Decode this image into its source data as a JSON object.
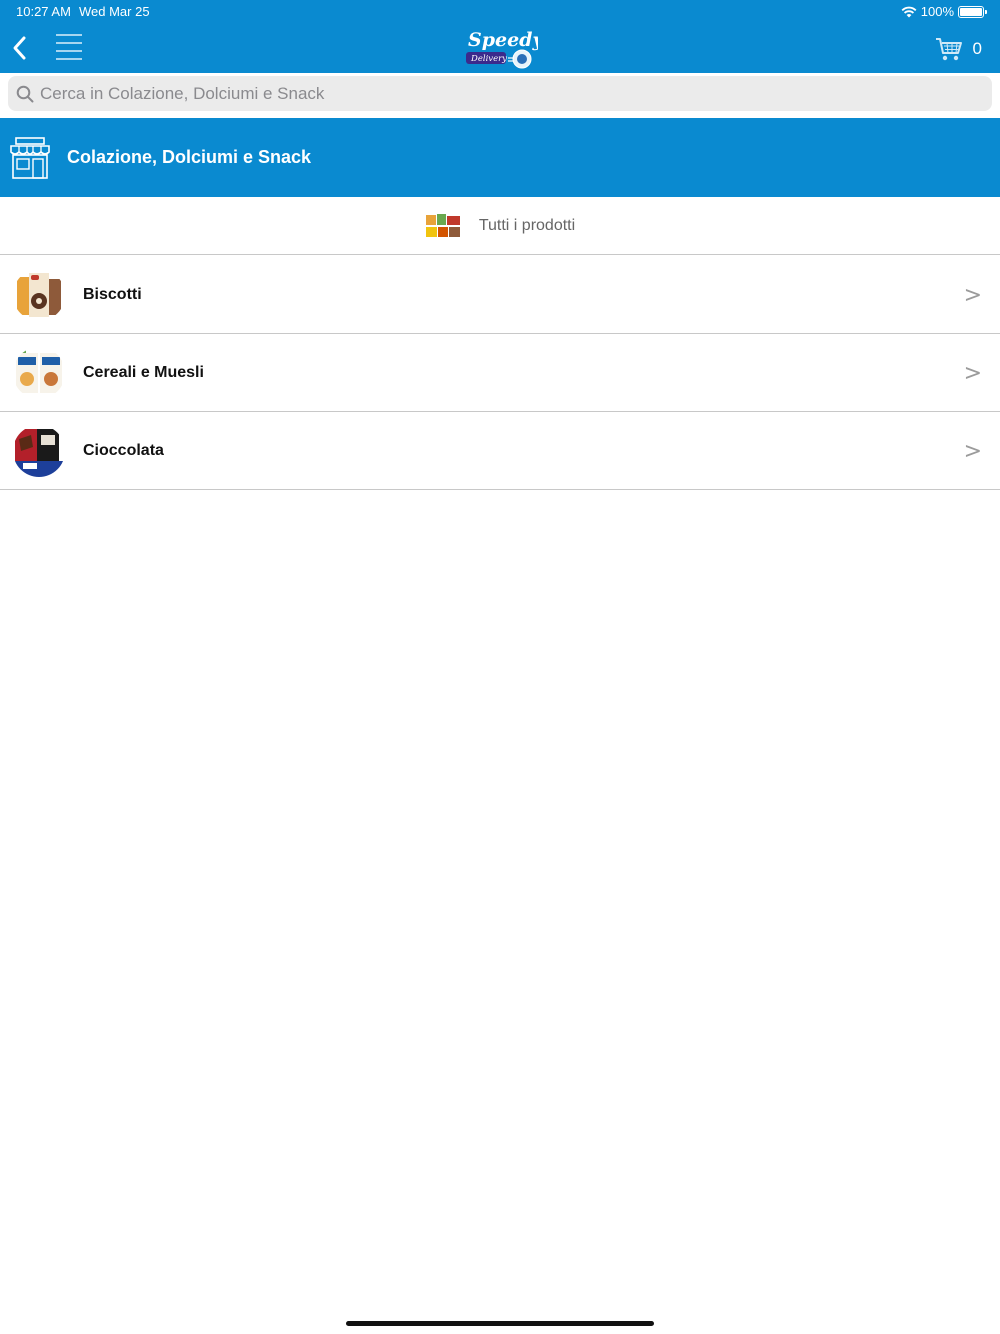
{
  "status_bar": {
    "time": "10:27 AM",
    "date": "Wed Mar 25",
    "battery": "100%",
    "battery_level": 1.0,
    "icons": [
      "wifi-icon",
      "battery-icon"
    ]
  },
  "nav": {
    "back_icon": "chevron-left-icon",
    "menu_icon": "hamburger-menu-icon",
    "logo_text": "Speedy",
    "logo_subtext": "Delivery",
    "cart_icon": "shopping-cart-icon",
    "cart_count": "0"
  },
  "search": {
    "placeholder": "Cerca in Colazione, Dolciumi e Snack",
    "value": "",
    "icon": "search-icon"
  },
  "category": {
    "icon": "store-icon",
    "title": "Colazione, Dolciumi e Snack"
  },
  "all_products": {
    "label": "Tutti i prodotti",
    "icon": "products-thumbnail"
  },
  "subcategories": [
    {
      "label": "Biscotti",
      "chevron": ">"
    },
    {
      "label": "Cereali e Muesli",
      "chevron": ">"
    },
    {
      "label": "Cioccolata",
      "chevron": ">"
    }
  ],
  "colors": {
    "brand_blue": "#0a8ad0",
    "search_bg": "#ebebeb",
    "divider": "#c8c8c8"
  }
}
